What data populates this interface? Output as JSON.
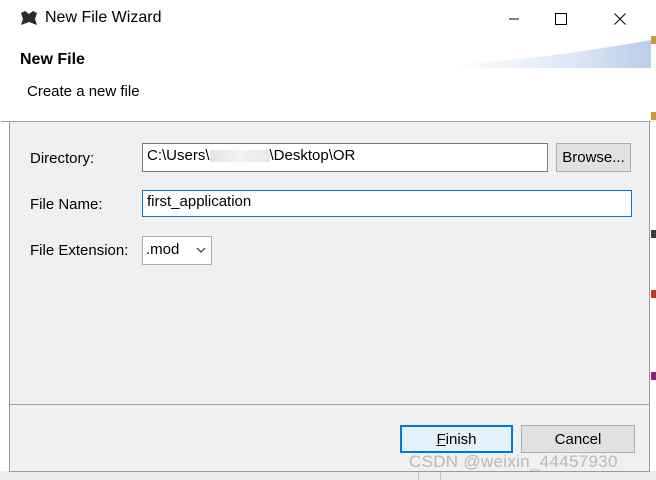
{
  "window": {
    "title": "New File Wizard",
    "controls": [
      "minimize",
      "maximize",
      "close"
    ]
  },
  "banner": {
    "title": "New File",
    "description": "Create a new file"
  },
  "form": {
    "directory": {
      "label": "Directory:",
      "value_prefix": "C:\\Users\\",
      "value_suffix": "\\Desktop\\OR",
      "browse_label": "Browse..."
    },
    "file_name": {
      "label": "File Name:",
      "value": "first_application"
    },
    "file_extension": {
      "label": "File Extension:",
      "selected": ".mod"
    }
  },
  "footer": {
    "finish_label": "Finish",
    "finish_mnemonic": "F",
    "finish_rest": "inish",
    "cancel_label": "Cancel"
  },
  "watermark": "CSDN @weixin_44457930",
  "colors": {
    "dialog_bg": "#f0f0f0",
    "focus_border": "#0078d7",
    "button_bg": "#e1e1e1"
  }
}
